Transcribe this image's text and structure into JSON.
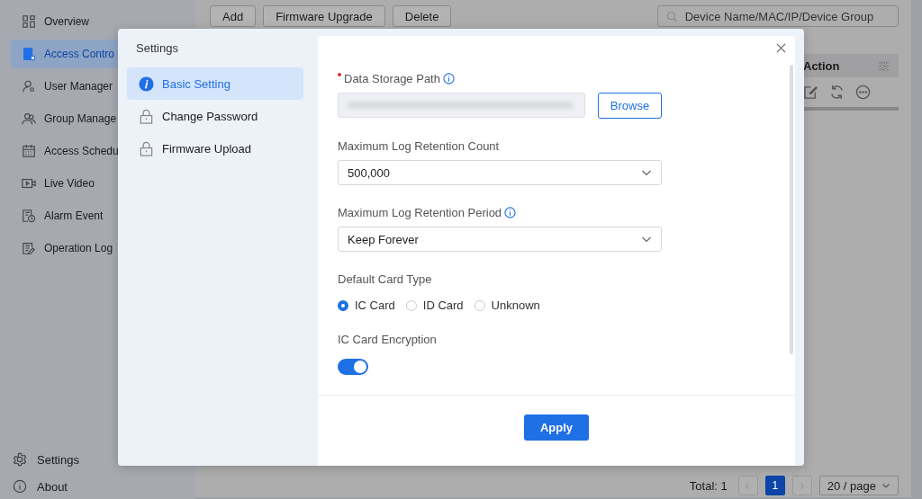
{
  "sidebar": {
    "items": [
      {
        "label": "Overview",
        "selected": false
      },
      {
        "label": "Access Contro",
        "selected": true
      },
      {
        "label": "User Manager",
        "selected": false
      },
      {
        "label": "Group Manage",
        "selected": false
      },
      {
        "label": "Access Schedu",
        "selected": false
      },
      {
        "label": "Live Video",
        "selected": false
      },
      {
        "label": "Alarm Event",
        "selected": false
      },
      {
        "label": "Operation Log",
        "selected": false
      }
    ],
    "footer": [
      {
        "label": "Settings"
      },
      {
        "label": "About"
      }
    ]
  },
  "toolbar": {
    "buttons": [
      "Add",
      "Firmware Upgrade",
      "Delete"
    ],
    "search": {
      "placeholder": "Device Name/MAC/IP/Device Group"
    }
  },
  "table": {
    "columns": [
      "Action"
    ]
  },
  "pagination": {
    "total": "Total: 1",
    "pages": [
      {
        "label": "1",
        "selected": true
      }
    ],
    "page_size": "20 / page"
  },
  "dialog": {
    "title": "Settings",
    "nav": [
      {
        "label": "Basic Setting",
        "selected": true
      },
      {
        "label": "Change Password",
        "selected": false
      },
      {
        "label": "Firmware Upload",
        "selected": false
      }
    ],
    "fields": [
      {
        "kind": "path",
        "label": "Data Storage Path",
        "required": true,
        "info": true,
        "button": "Browse"
      },
      {
        "kind": "select",
        "label": "Maximum Log Retention Count",
        "required": false,
        "info": false,
        "value": "500,000"
      },
      {
        "kind": "select",
        "label": "Maximum Log Retention Period",
        "required": false,
        "info": true,
        "value": "Keep Forever"
      },
      {
        "kind": "radio",
        "label": "Default Card Type",
        "required": false,
        "info": false,
        "options": [
          {
            "label": "IC Card",
            "selected": true
          },
          {
            "label": "ID Card",
            "selected": false
          },
          {
            "label": "Unknown",
            "selected": false
          }
        ]
      },
      {
        "kind": "switch",
        "label": "IC Card Encryption",
        "required": false,
        "info": false,
        "on": true
      }
    ],
    "apply": "Apply"
  }
}
